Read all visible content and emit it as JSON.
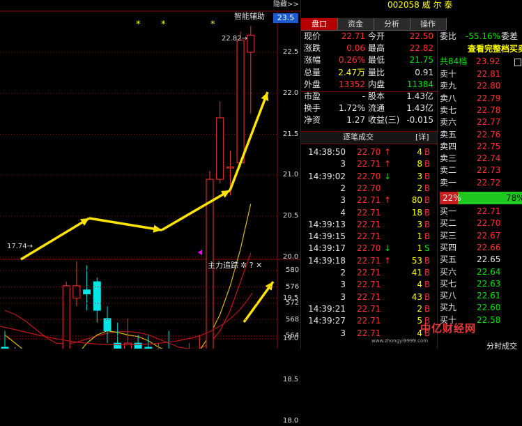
{
  "top": {
    "hide_label": "隐藏>>",
    "assist_label": "智能辅助",
    "price_box": "23.5",
    "stock_title": "002058 威 尔 泰"
  },
  "chart": {
    "price_ticks": [
      "22.5",
      "22.0",
      "21.5",
      "21.0",
      "20.5",
      "20.0",
      "19.5",
      "19.0",
      "18.5",
      "18.0"
    ],
    "high_label": "22.82→",
    "low_label": "17.74→",
    "stars": [
      "*",
      "*",
      "*"
    ],
    "candles": [
      {
        "o": 18.9,
        "c": 18.65,
        "h": 19.1,
        "l": 18.4
      },
      {
        "o": 18.7,
        "c": 18.5,
        "h": 18.9,
        "l": 18.3
      },
      {
        "o": 18.6,
        "c": 18.2,
        "h": 18.7,
        "l": 18.0
      },
      {
        "o": 18.15,
        "c": 17.95,
        "h": 18.25,
        "l": 17.74
      },
      {
        "o": 17.95,
        "c": 18.0,
        "h": 18.05,
        "l": 17.85
      },
      {
        "o": 18.0,
        "c": 18.05,
        "h": 18.1,
        "l": 17.9
      },
      {
        "o": 18.05,
        "c": 19.65,
        "h": 19.7,
        "l": 18.0
      },
      {
        "o": 19.5,
        "c": 19.65,
        "h": 19.95,
        "l": 19.4
      },
      {
        "o": 19.6,
        "c": 19.55,
        "h": 19.9,
        "l": 19.35
      },
      {
        "o": 19.7,
        "c": 19.35,
        "h": 19.75,
        "l": 19.2
      },
      {
        "o": 19.25,
        "c": 19.1,
        "h": 19.4,
        "l": 18.95
      },
      {
        "o": 18.95,
        "c": 18.85,
        "h": 19.2,
        "l": 18.75
      },
      {
        "o": 18.85,
        "c": 18.95,
        "h": 19.25,
        "l": 18.8
      },
      {
        "o": 18.95,
        "c": 18.85,
        "h": 19.05,
        "l": 18.7
      },
      {
        "o": 18.9,
        "c": 18.8,
        "h": 19.05,
        "l": 18.65
      },
      {
        "o": 18.75,
        "c": 18.8,
        "h": 18.95,
        "l": 18.6
      },
      {
        "o": 18.8,
        "c": 18.55,
        "h": 19.1,
        "l": 18.35
      },
      {
        "o": 18.55,
        "c": 18.65,
        "h": 18.8,
        "l": 18.4
      },
      {
        "o": 18.8,
        "c": 18.85,
        "h": 18.95,
        "l": 18.75
      },
      {
        "o": 18.7,
        "c": 18.85,
        "h": 19.05,
        "l": 18.6
      },
      {
        "o": 18.8,
        "c": 20.95,
        "h": 21.05,
        "l": 18.75
      },
      {
        "o": 20.95,
        "c": 21.7,
        "h": 21.9,
        "l": 20.9
      },
      {
        "o": 21.1,
        "c": 21.1,
        "h": 21.3,
        "l": 20.75
      },
      {
        "o": 21.15,
        "c": 22.65,
        "h": 22.75,
        "l": 21.1
      },
      {
        "o": 22.5,
        "c": 22.71,
        "h": 22.82,
        "l": 21.75
      }
    ],
    "ma_yellow": [
      19.05,
      18.95,
      18.85,
      18.7,
      18.6,
      18.55,
      18.65,
      18.8,
      18.95,
      19.05,
      19.1,
      19.08,
      19.05,
      19.03,
      18.98,
      18.9,
      18.85,
      18.82,
      18.82,
      18.86,
      19.05,
      19.3,
      19.65,
      20.1,
      20.65
    ],
    "ma_red": [
      19.35,
      19.3,
      19.22,
      19.12,
      19.02,
      18.95,
      18.94,
      18.96,
      19.0,
      19.04,
      19.07,
      19.09,
      19.09,
      19.08,
      19.05,
      19.0,
      18.95,
      18.9,
      18.88,
      18.88,
      18.95,
      19.1,
      19.35,
      19.7,
      20.05
    ],
    "sub_title": "主力追踪",
    "sub_icons": "✲ ? ✕",
    "sub_ticks": [
      "580",
      "576",
      "572",
      "568",
      "564"
    ]
  },
  "tabs": [
    "盘口",
    "资金",
    "分析",
    "操作"
  ],
  "quote": {
    "rows": [
      {
        "l1": "现价",
        "v1": "22.71",
        "c1": "red",
        "l2": "今开",
        "v2": "22.50",
        "c2": "red"
      },
      {
        "l1": "涨跌",
        "v1": "0.06",
        "c1": "red",
        "l2": "最高",
        "v2": "22.82",
        "c2": "red"
      },
      {
        "l1": "涨幅",
        "v1": "0.26%",
        "c1": "red",
        "l2": "最低",
        "v2": "21.75",
        "c2": "green"
      },
      {
        "l1": "总量",
        "v1": "2.47万",
        "c1": "yellow",
        "l2": "量比",
        "v2": "0.91",
        "c2": "white"
      },
      {
        "l1": "外盘",
        "v1": "13352",
        "c1": "red",
        "l2": "内盘",
        "v2": "11384",
        "c2": "green"
      },
      {
        "l1": "市盈",
        "v1": "-",
        "c1": "white",
        "l2": "股本",
        "v2": "1.43亿",
        "c2": "white"
      },
      {
        "l1": "换手",
        "v1": "1.72%",
        "c1": "white",
        "l2": "流通",
        "v2": "1.43亿",
        "c2": "white"
      },
      {
        "l1": "净资",
        "v1": "1.27",
        "c1": "white",
        "l2": "收益(三)",
        "v2": "-0.015",
        "c2": "white"
      }
    ],
    "ticks_title": "逐笔成交",
    "ticks_detail": "[详]",
    "ticks": [
      {
        "t": "14:38:50",
        "p": "22.70",
        "a": "↑",
        "ac": "red",
        "v": "4",
        "d": "B",
        "dc": "red"
      },
      {
        "t": "3",
        "p": "22.71",
        "a": "↑",
        "ac": "red",
        "v": "8",
        "d": "B",
        "dc": "red"
      },
      {
        "t": "14:39:02",
        "p": "22.70",
        "a": "↓",
        "ac": "green",
        "v": "3",
        "d": "B",
        "dc": "red"
      },
      {
        "t": "2",
        "p": "22.70",
        "a": "",
        "ac": "red",
        "v": "2",
        "d": "B",
        "dc": "red"
      },
      {
        "t": "3",
        "p": "22.71",
        "a": "↑",
        "ac": "red",
        "v": "80",
        "d": "B",
        "dc": "red"
      },
      {
        "t": "4",
        "p": "22.71",
        "a": "",
        "ac": "red",
        "v": "18",
        "d": "B",
        "dc": "red"
      },
      {
        "t": "14:39:13",
        "p": "22.71",
        "a": "",
        "ac": "red",
        "v": "3",
        "d": "B",
        "dc": "red"
      },
      {
        "t": "14:39:15",
        "p": "22.71",
        "a": "",
        "ac": "red",
        "v": "1",
        "d": "B",
        "dc": "red"
      },
      {
        "t": "14:39:17",
        "p": "22.70",
        "a": "↓",
        "ac": "green",
        "v": "1",
        "d": "S",
        "dc": "green"
      },
      {
        "t": "14:39:18",
        "p": "22.71",
        "a": "↑",
        "ac": "red",
        "v": "53",
        "d": "B",
        "dc": "red"
      },
      {
        "t": "2",
        "p": "22.71",
        "a": "",
        "ac": "red",
        "v": "41",
        "d": "B",
        "dc": "red"
      },
      {
        "t": "3",
        "p": "22.71",
        "a": "",
        "ac": "red",
        "v": "4",
        "d": "B",
        "dc": "red"
      },
      {
        "t": "3",
        "p": "22.71",
        "a": "",
        "ac": "red",
        "v": "43",
        "d": "B",
        "dc": "red"
      },
      {
        "t": "14:39:21",
        "p": "22.71",
        "a": "",
        "ac": "red",
        "v": "2",
        "d": "B",
        "dc": "red"
      },
      {
        "t": "14:39:27",
        "p": "22.71",
        "a": "",
        "ac": "red",
        "v": "5",
        "d": "B",
        "dc": "red"
      },
      {
        "t": "3",
        "p": "22.71",
        "a": "",
        "ac": "red",
        "v": "4",
        "d": "B",
        "dc": "red"
      }
    ]
  },
  "orderbook": {
    "weibi_label": "委比",
    "weibi_value": "-55.16%",
    "weicha_label": "委差",
    "full_link": "查看完整档买卖",
    "total_label": "共84档",
    "total_value": "23.92",
    "sell": [
      {
        "l": "卖十",
        "p": "22.81"
      },
      {
        "l": "卖九",
        "p": "22.80"
      },
      {
        "l": "卖八",
        "p": "22.79"
      },
      {
        "l": "卖七",
        "p": "22.78"
      },
      {
        "l": "卖六",
        "p": "22.77"
      },
      {
        "l": "卖五",
        "p": "22.76"
      },
      {
        "l": "卖四",
        "p": "22.75"
      },
      {
        "l": "卖三",
        "p": "22.74"
      },
      {
        "l": "卖二",
        "p": "22.73"
      },
      {
        "l": "卖一",
        "p": "22.72"
      }
    ],
    "bar_left": "22%",
    "bar_right": "78%",
    "buy": [
      {
        "l": "买一",
        "p": "22.71",
        "c": "red"
      },
      {
        "l": "买二",
        "p": "22.70",
        "c": "red"
      },
      {
        "l": "买三",
        "p": "22.67",
        "c": "red"
      },
      {
        "l": "买四",
        "p": "22.66",
        "c": "red"
      },
      {
        "l": "买五",
        "p": "22.65",
        "c": "white"
      },
      {
        "l": "买六",
        "p": "22.64",
        "c": "green"
      },
      {
        "l": "买七",
        "p": "22.63",
        "c": "green"
      },
      {
        "l": "买八",
        "p": "22.61",
        "c": "green"
      },
      {
        "l": "买九",
        "p": "22.60",
        "c": "green"
      },
      {
        "l": "买十",
        "p": "22.58",
        "c": "green"
      }
    ],
    "bottom_label": "分时成交"
  },
  "watermark": {
    "brand": "中亿财经网",
    "url": "www.zhongyi9999.com"
  }
}
